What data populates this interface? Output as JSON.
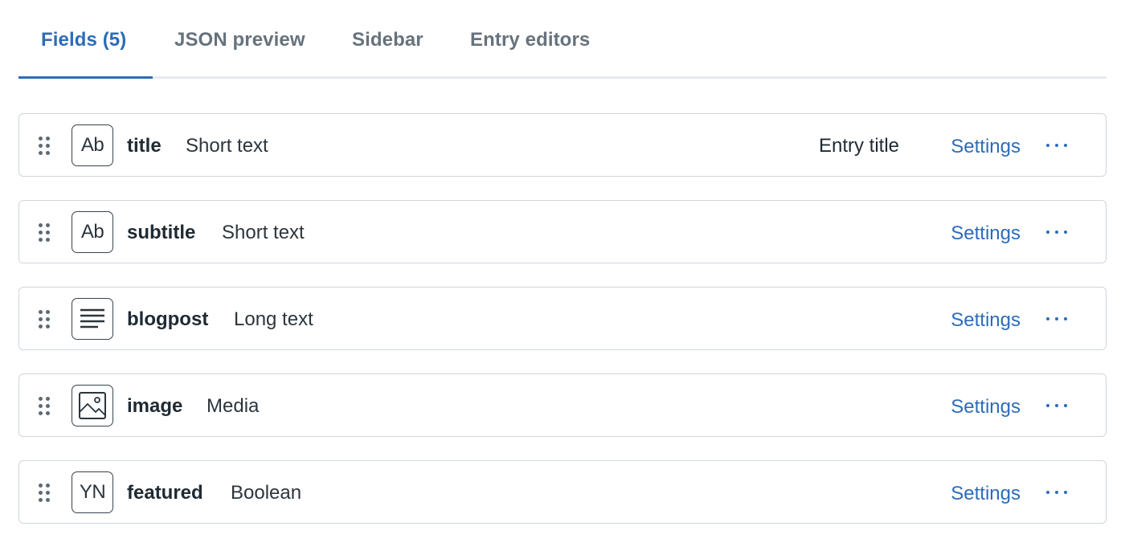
{
  "tabs": [
    {
      "label": "Fields (5)",
      "active": true
    },
    {
      "label": "JSON preview",
      "active": false
    },
    {
      "label": "Sidebar",
      "active": false
    },
    {
      "label": "Entry editors",
      "active": false
    }
  ],
  "fields": [
    {
      "name": "title",
      "type": "Short text",
      "icon": "short-text-icon",
      "icon_text": "Ab",
      "badge": "Entry title",
      "settings_label": "Settings"
    },
    {
      "name": "subtitle",
      "type": "Short text",
      "icon": "short-text-icon",
      "icon_text": "Ab",
      "badge": "",
      "settings_label": "Settings"
    },
    {
      "name": "blogpost",
      "type": "Long text",
      "icon": "long-text-icon",
      "icon_text": "",
      "badge": "",
      "settings_label": "Settings"
    },
    {
      "name": "image",
      "type": "Media",
      "icon": "media-icon",
      "icon_text": "",
      "badge": "",
      "settings_label": "Settings"
    },
    {
      "name": "featured",
      "type": "Boolean",
      "icon": "boolean-icon",
      "icon_text": "YN",
      "badge": "",
      "settings_label": "Settings"
    }
  ],
  "colors": {
    "accent": "#2d6cb8",
    "border": "#cfd6dc",
    "tab_inactive": "#66727c"
  }
}
